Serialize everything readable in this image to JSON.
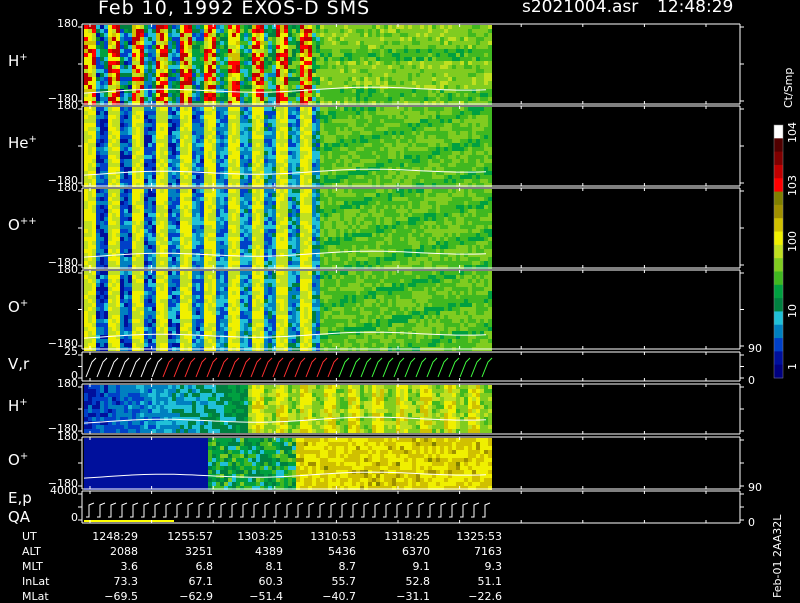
{
  "header": {
    "title": "Feb 10, 1992   EXOS-D SMS",
    "filename": "s2021004.asr",
    "time": "12:48:29"
  },
  "chart_data": {
    "type": "heatmap",
    "panels": [
      {
        "label": "H",
        "sup": "+",
        "ytop": "180",
        "ybot": "−180"
      },
      {
        "label": "He",
        "sup": "+",
        "ytop": "180",
        "ybot": "−180"
      },
      {
        "label": "O",
        "sup": "++",
        "ytop": "180",
        "ybot": "−180"
      },
      {
        "label": "O",
        "sup": "+",
        "ytop": "180",
        "ybot": "−180"
      },
      {
        "label": "V,r",
        "sup": "",
        "ytop": "25",
        "ybot": "0",
        "rtop": "90",
        "rbot": "0"
      },
      {
        "label": "H",
        "sup": "+",
        "ytop": "180",
        "ybot": "−180"
      },
      {
        "label": "O",
        "sup": "+",
        "ytop": "180",
        "ybot": "−180"
      },
      {
        "label": "E,p",
        "label2": "QA",
        "sup": "",
        "ytop": "4000",
        "ybot": "0",
        "rtop": "90",
        "rbot": "0"
      }
    ],
    "colorbar": {
      "unit": "Ct/Smp",
      "ticks": [
        "1",
        "10",
        "100",
        "10^3",
        "10^4"
      ],
      "colors": [
        "#000080",
        "#00109c",
        "#0040c8",
        "#0080c0",
        "#20c0d8",
        "#008040",
        "#00a040",
        "#40b820",
        "#80cc20",
        "#c0e020",
        "#f0f000",
        "#d0c000",
        "#a09000",
        "#808000",
        "#ff0000",
        "#c00000",
        "#800000",
        "#500000",
        "#ffffff"
      ]
    }
  },
  "table": {
    "rows": [
      {
        "label": "UT",
        "values": [
          "1248:29",
          "1255:57",
          "1303:25",
          "1310:53",
          "1318:25",
          "1325:53"
        ]
      },
      {
        "label": "ALT",
        "values": [
          "2088",
          "3251",
          "4389",
          "5436",
          "6370",
          "7163"
        ]
      },
      {
        "label": "MLT",
        "values": [
          "3.6",
          "6.8",
          "8.1",
          "8.7",
          "9.1",
          "9.3"
        ]
      },
      {
        "label": "InLat",
        "values": [
          "73.3",
          "67.1",
          "60.3",
          "55.7",
          "52.8",
          "51.1"
        ]
      },
      {
        "label": "MLat",
        "values": [
          "−69.5",
          "−62.9",
          "−51.4",
          "−40.7",
          "−31.1",
          "−22.6"
        ]
      }
    ]
  },
  "stamp": "Feb-01 2AA32L"
}
